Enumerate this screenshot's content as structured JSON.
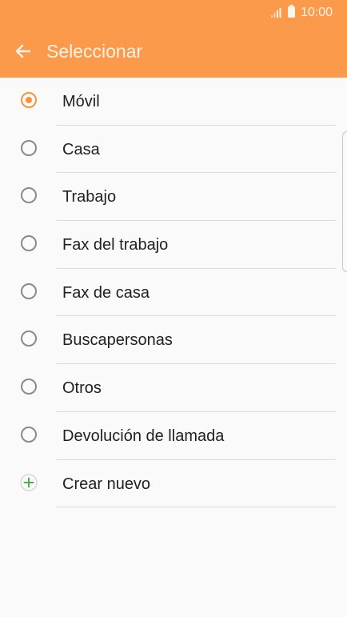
{
  "status_bar": {
    "time": "10:00",
    "signal_icon": "signal-bars-icon",
    "battery_icon": "battery-icon"
  },
  "header": {
    "title": "Seleccionar",
    "back_icon": "back-arrow-icon"
  },
  "colors": {
    "accent": "#fb9a4b",
    "radio_selected": "#f7943a",
    "add_green": "#4caf50"
  },
  "options": [
    {
      "label": "Móvil",
      "selected": true
    },
    {
      "label": "Casa",
      "selected": false
    },
    {
      "label": "Trabajo",
      "selected": false
    },
    {
      "label": "Fax del trabajo",
      "selected": false
    },
    {
      "label": "Fax de casa",
      "selected": false
    },
    {
      "label": "Buscapersonas",
      "selected": false
    },
    {
      "label": "Otros",
      "selected": false
    },
    {
      "label": "Devolución de llamada",
      "selected": false
    }
  ],
  "create_new": {
    "label": "Crear nuevo",
    "icon": "plus-circle-icon"
  }
}
